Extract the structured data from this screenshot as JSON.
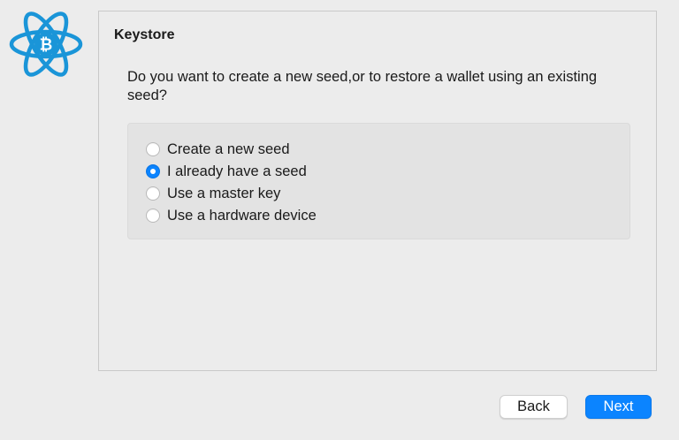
{
  "logo": {
    "icon": "electrum-bitcoin-atom-icon",
    "color": "#1a95d8"
  },
  "panel": {
    "title": "Keystore",
    "question": "Do you want to create a new seed,or to restore a wallet using an existing seed?"
  },
  "options": [
    {
      "label": "Create a new seed",
      "checked": false
    },
    {
      "label": "I already have a seed",
      "checked": true
    },
    {
      "label": "Use a master key",
      "checked": false
    },
    {
      "label": "Use a hardware device",
      "checked": false
    }
  ],
  "buttons": {
    "back_label": "Back",
    "next_label": "Next"
  },
  "colors": {
    "accent": "#0b84ff",
    "window_bg": "#ececec"
  }
}
